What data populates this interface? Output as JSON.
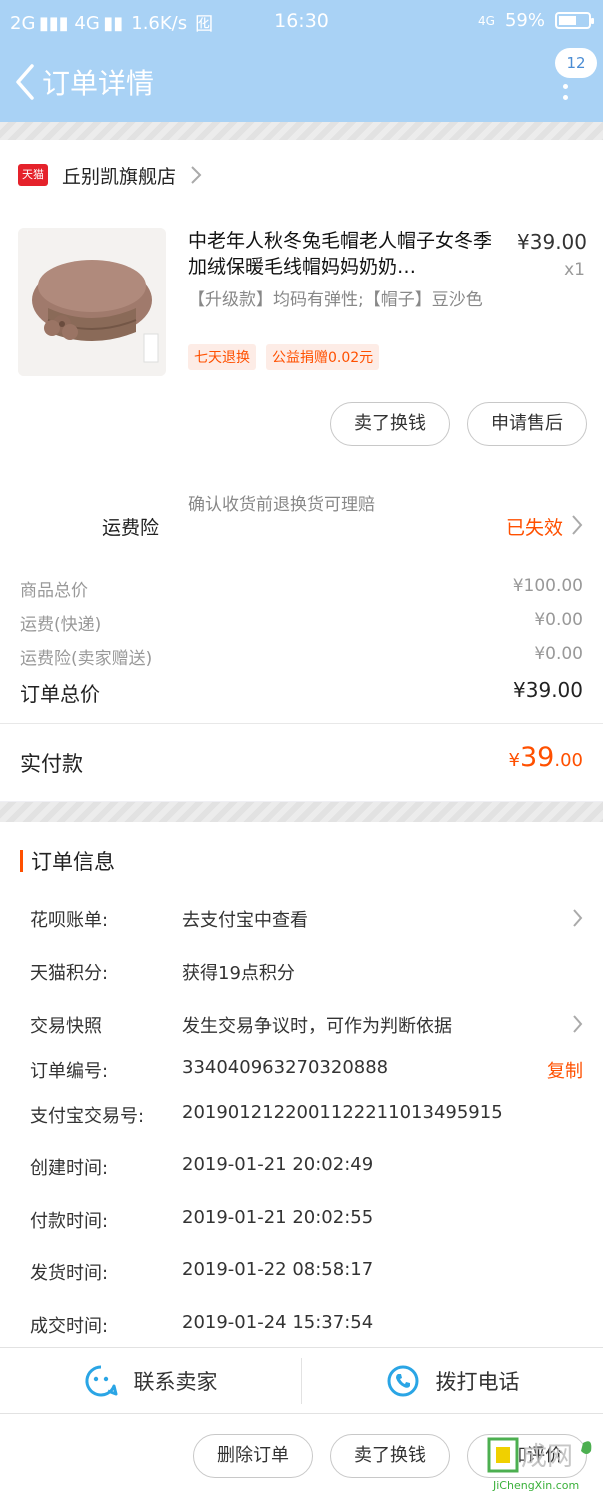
{
  "status_bar": {
    "network": "2G ▮▮▮ 4G ▮▮",
    "speed": "1.6K/s",
    "sim_icon": "囮",
    "time": "16:30",
    "signal_4g": "4G",
    "battery_percent": "59%",
    "battery_level": 0.59
  },
  "nav": {
    "title": "订单详情",
    "badge": "12"
  },
  "shop": {
    "logo_text": "天猫",
    "name": "丘别凯旗舰店"
  },
  "product": {
    "title": "中老年人秋冬兔毛帽老人帽子女冬季加绒保暖毛线帽妈妈奶奶…",
    "price": "¥39.00",
    "qty": "x1",
    "spec": "【升级款】均码有弹性;【帽子】豆沙色",
    "tags": [
      "七天退换",
      "公益捐赠0.02元"
    ],
    "image_label": "豆沙色"
  },
  "actions": {
    "sell": "卖了换钱",
    "after_sale": "申请售后"
  },
  "insurance": {
    "label": "运费险",
    "desc": "确认收货前退换货可理赔",
    "status": "已失效"
  },
  "fees": [
    {
      "label": "商品总价",
      "value": "¥100.00"
    },
    {
      "label": "运费(快递)",
      "value": "¥0.00"
    },
    {
      "label": "运费险(卖家赠送)",
      "value": "¥0.00"
    }
  ],
  "order_total": {
    "label": "订单总价",
    "value": "¥39.00"
  },
  "paid": {
    "label": "实付款",
    "symbol": "¥",
    "integer": "39",
    "decimal": ".00"
  },
  "order_info": {
    "title": "订单信息",
    "rows": [
      {
        "label": "花呗账单:",
        "value": "去支付宝中查看"
      },
      {
        "label": "天猫积分:",
        "value": "获得19点积分"
      },
      {
        "label": "交易快照",
        "value": "发生交易争议时，可作为判断依据"
      },
      {
        "label": "订单编号:",
        "value": "334040963270320888"
      },
      {
        "label": "支付宝交易号:",
        "value": "2019012122001122211013495915"
      },
      {
        "label": "创建时间:",
        "value": "2019-01-21 20:02:49"
      },
      {
        "label": "付款时间:",
        "value": "2019-01-21 20:02:55"
      },
      {
        "label": "发货时间:",
        "value": "2019-01-22 08:58:17"
      },
      {
        "label": "成交时间:",
        "value": "2019-01-24 15:37:54"
      }
    ],
    "copy_label": "复制"
  },
  "contact": {
    "seller": "联系卖家",
    "phone": "拨打电话"
  },
  "bottom_actions": {
    "delete": "删除订单",
    "sell": "卖了换钱",
    "review": "追加评价"
  },
  "watermark": {
    "logo": "集成网",
    "url": "JiChengXin.com"
  },
  "colors": {
    "accent": "#ff5000",
    "header": "#a9d2f5",
    "tmall": "#e5222b",
    "contact_icon": "#2aa5e5"
  }
}
